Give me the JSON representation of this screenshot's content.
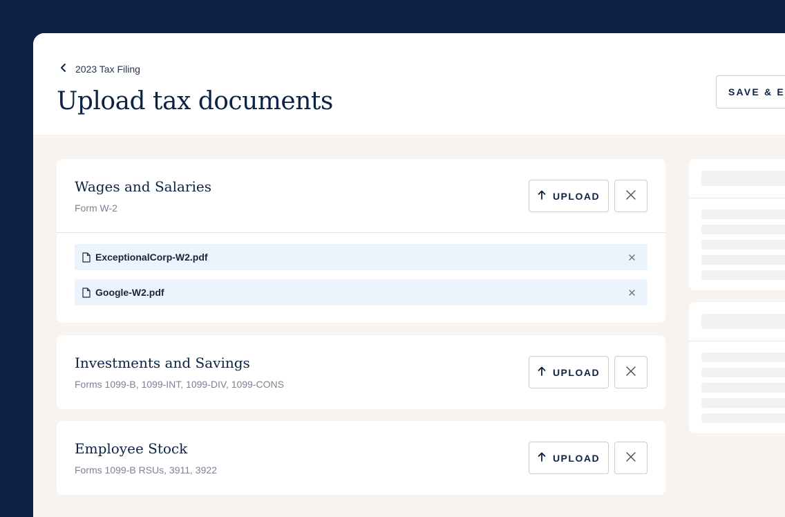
{
  "header": {
    "breadcrumb": "2023 Tax Filing",
    "title": "Upload tax documents",
    "save_exit_label": "SAVE & EXIT"
  },
  "upload_label": "UPLOAD",
  "cards": [
    {
      "title": "Wages and Salaries",
      "subtitle": "Form W-2",
      "files": [
        "ExceptionalCorp-W2.pdf",
        "Google-W2.pdf"
      ]
    },
    {
      "title": "Investments and Savings",
      "subtitle": "Forms 1099-B, 1099-INT, 1099-DIV, 1099-CONS",
      "files": []
    },
    {
      "title": "Employee Stock",
      "subtitle": "Forms 1099-B RSUs, 3911, 3922",
      "files": []
    }
  ],
  "icons": {
    "back": "chevron-left-icon",
    "upload": "arrow-up-icon",
    "close": "close-icon",
    "file": "document-icon",
    "remove": "small-close-icon"
  },
  "colors": {
    "navy": "#0b2244",
    "background": "#f8f3ef",
    "file_chip": "#ebf3fc"
  }
}
